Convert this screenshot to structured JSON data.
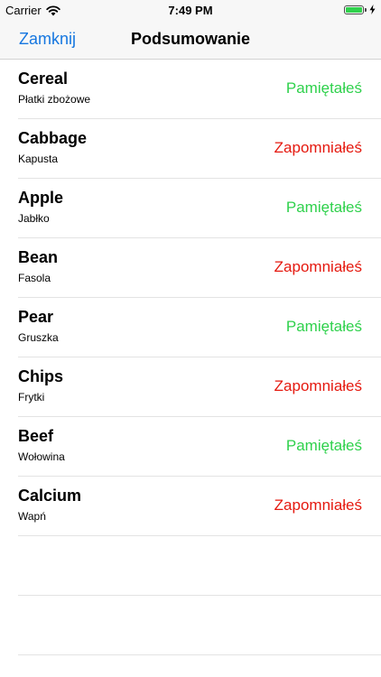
{
  "status_bar": {
    "carrier": "Carrier",
    "time": "7:49 PM"
  },
  "nav": {
    "close_label": "Zamknij",
    "title": "Podsumowanie"
  },
  "colors": {
    "remembered": "#2fd14c",
    "forgotten": "#e5190f",
    "accent": "#1677e0"
  },
  "items": [
    {
      "word": "Cereal",
      "translation": "Płatki zbożowe",
      "result": "Pamiętałeś",
      "state": "remembered"
    },
    {
      "word": "Cabbage",
      "translation": "Kapusta",
      "result": "Zapomniałeś",
      "state": "forgotten"
    },
    {
      "word": "Apple",
      "translation": "Jabłko",
      "result": "Pamiętałeś",
      "state": "remembered"
    },
    {
      "word": "Bean",
      "translation": "Fasola",
      "result": "Zapomniałeś",
      "state": "forgotten"
    },
    {
      "word": "Pear",
      "translation": "Gruszka",
      "result": "Pamiętałeś",
      "state": "remembered"
    },
    {
      "word": "Chips",
      "translation": "Frytki",
      "result": "Zapomniałeś",
      "state": "forgotten"
    },
    {
      "word": "Beef",
      "translation": "Wołowina",
      "result": "Pamiętałeś",
      "state": "remembered"
    },
    {
      "word": "Calcium",
      "translation": "Wapń",
      "result": "Zapomniałeś",
      "state": "forgotten"
    }
  ]
}
